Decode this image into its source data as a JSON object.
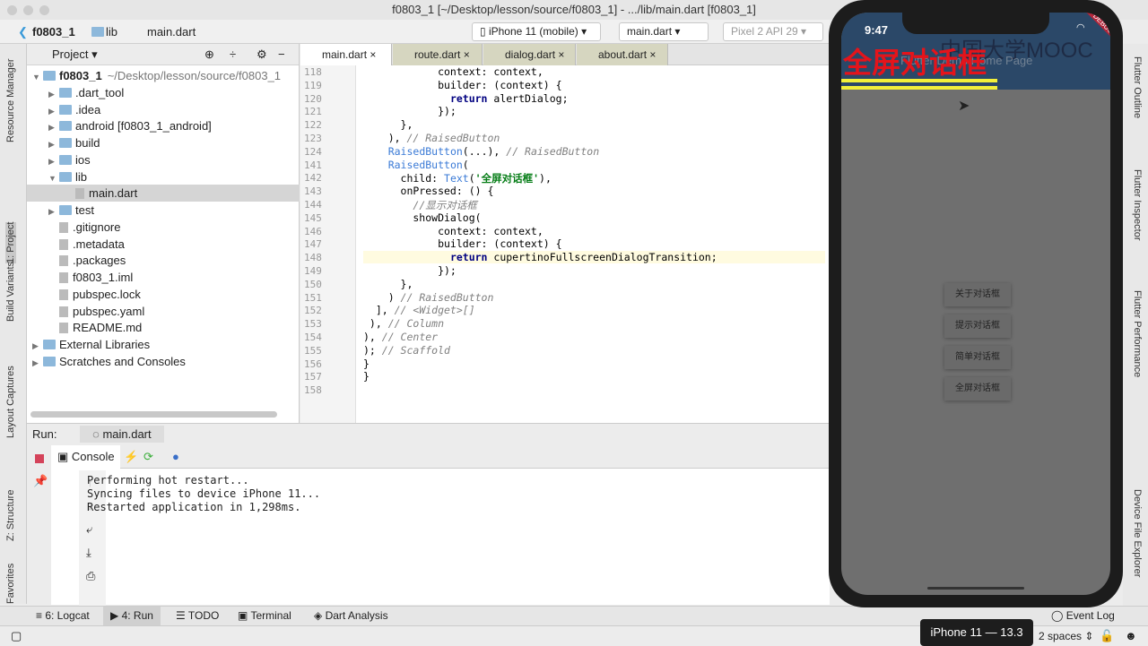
{
  "window": {
    "title": "f0803_1 [~/Desktop/lesson/source/f0803_1] - .../lib/main.dart [f0803_1]"
  },
  "nav": {
    "crumbs": [
      "f0803_1",
      "lib",
      "main.dart"
    ],
    "device": "iPhone 11 (mobile)",
    "run_config": "main.dart",
    "emulator": "Pixel 2 API 29"
  },
  "left_strip": [
    "Resource Manager",
    "1: Project",
    "Build Variants",
    "Layout Captures",
    "Z: Structure",
    "Favorites"
  ],
  "project": {
    "title": "Project",
    "items": [
      {
        "label": "f0803_1",
        "extra": "~/Desktop/lesson/source/f0803_1",
        "depth": 0,
        "open": true,
        "type": "folder"
      },
      {
        "label": ".dart_tool",
        "depth": 1,
        "type": "folder"
      },
      {
        "label": ".idea",
        "depth": 1,
        "type": "folder"
      },
      {
        "label": "android [f0803_1_android]",
        "depth": 1,
        "type": "folder"
      },
      {
        "label": "build",
        "depth": 1,
        "type": "folder"
      },
      {
        "label": "ios",
        "depth": 1,
        "type": "folder"
      },
      {
        "label": "lib",
        "depth": 1,
        "open": true,
        "type": "folder"
      },
      {
        "label": "main.dart",
        "depth": 2,
        "type": "file",
        "selected": true
      },
      {
        "label": "test",
        "depth": 1,
        "type": "folder"
      },
      {
        "label": ".gitignore",
        "depth": 1,
        "type": "file"
      },
      {
        "label": ".metadata",
        "depth": 1,
        "type": "file"
      },
      {
        "label": ".packages",
        "depth": 1,
        "type": "file"
      },
      {
        "label": "f0803_1.iml",
        "depth": 1,
        "type": "file"
      },
      {
        "label": "pubspec.lock",
        "depth": 1,
        "type": "file"
      },
      {
        "label": "pubspec.yaml",
        "depth": 1,
        "type": "file"
      },
      {
        "label": "README.md",
        "depth": 1,
        "type": "file"
      },
      {
        "label": "External Libraries",
        "depth": 0,
        "type": "lib"
      },
      {
        "label": "Scratches and Consoles",
        "depth": 0,
        "type": "lib"
      }
    ]
  },
  "editor": {
    "tabs": [
      "main.dart",
      "route.dart",
      "dialog.dart",
      "about.dart"
    ],
    "lines": [
      {
        "n": "118",
        "html": "            context: context,"
      },
      {
        "n": "119",
        "html": "            builder: (context) {"
      },
      {
        "n": "120",
        "html": "              <span class='kw'>return</span> alertDialog;"
      },
      {
        "n": "121",
        "html": "            });"
      },
      {
        "n": "122",
        "html": "      },"
      },
      {
        "n": "123",
        "html": "    ), <span class='cm'>// RaisedButton</span>"
      },
      {
        "n": "124",
        "html": "    <span class='cls'>RaisedButton</span>(...), <span class='cm'>// RaisedButton</span>"
      },
      {
        "n": "141",
        "html": "    <span class='cls'>RaisedButton</span>("
      },
      {
        "n": "142",
        "html": "      child: <span class='cls'>Text</span>(<span class='str'>'全屏对话框'</span>),"
      },
      {
        "n": "143",
        "html": "      onPressed: () {"
      },
      {
        "n": "144",
        "html": "        <span class='cm'>//显示对话框</span>"
      },
      {
        "n": "145",
        "html": "        showDialog("
      },
      {
        "n": "146",
        "html": "            context: context,"
      },
      {
        "n": "147",
        "html": "            builder: (context) {"
      },
      {
        "n": "148",
        "html": "              <span class='kw'>return</span> cupertinoFullscreenDialogTransition;",
        "hl": true
      },
      {
        "n": "149",
        "html": "            });"
      },
      {
        "n": "150",
        "html": "      },"
      },
      {
        "n": "151",
        "html": "    ) <span class='cm'>// RaisedButton</span>"
      },
      {
        "n": "152",
        "html": "  ], <span class='cm'>// &lt;Widget&gt;[]</span>"
      },
      {
        "n": "153",
        "html": " ), <span class='cm'>// Column</span>"
      },
      {
        "n": "154",
        "html": "), <span class='cm'>// Center</span>"
      },
      {
        "n": "155",
        "html": "); <span class='cm'>// Scaffold</span>"
      },
      {
        "n": "156",
        "html": "}"
      },
      {
        "n": "157",
        "html": "}"
      },
      {
        "n": "158",
        "html": ""
      }
    ]
  },
  "run": {
    "label": "Run:",
    "tab": "main.dart",
    "console_tab": "Console",
    "output": [
      "Performing hot restart...",
      "Syncing files to device iPhone 11...",
      "Restarted application in 1,298ms."
    ]
  },
  "bottom": {
    "tabs": [
      "6: Logcat",
      "4: Run",
      "TODO",
      "Terminal",
      "Dart Analysis"
    ],
    "event_log": "Event Log"
  },
  "status": {
    "indent": "2 spaces",
    "device_tooltip": "iPhone 11 — 13.3"
  },
  "right_strip": [
    "Flutter Outline",
    "Flutter Inspector",
    "Flutter Performance",
    "Device File Explorer"
  ],
  "phone": {
    "time": "9:47",
    "appbar_title": "Flutter Demo Home Page",
    "debug": "DEBUG",
    "overlay_text": "全屏对话框",
    "watermark": "中国大学MOOC",
    "buttons": [
      "关于对话框",
      "提示对话框",
      "简单对话框",
      "全屏对话框"
    ],
    "colors": {
      "overlay_text": "#e5141b",
      "underline": "#f3f03a",
      "appbar": "#2b4868"
    }
  }
}
